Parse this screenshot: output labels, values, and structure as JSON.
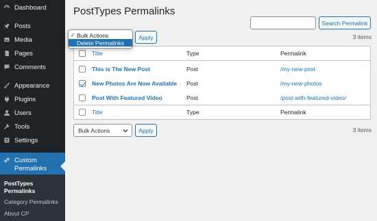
{
  "sidebar": {
    "items": [
      {
        "label": "Dashboard",
        "icon": "dashboard-icon"
      },
      {
        "label": "Posts",
        "icon": "pin-icon"
      },
      {
        "label": "Media",
        "icon": "media-icon"
      },
      {
        "label": "Pages",
        "icon": "pages-icon"
      },
      {
        "label": "Comments",
        "icon": "comments-icon"
      },
      {
        "label": "Appearance",
        "icon": "brush-icon"
      },
      {
        "label": "Plugins",
        "icon": "plugin-icon"
      },
      {
        "label": "Users",
        "icon": "user-icon"
      },
      {
        "label": "Tools",
        "icon": "wrench-icon"
      },
      {
        "label": "Settings",
        "icon": "settings-icon"
      }
    ],
    "active": {
      "label_line1": "Custom",
      "label_line2": "Permalinks",
      "icon": "link-icon"
    },
    "submenu": {
      "current_line1": "PostTypes",
      "current_line2": "Permalinks",
      "items": [
        "Category Permalinks",
        "About CP"
      ]
    }
  },
  "main": {
    "title": "PostTypes Permalinks",
    "search_button": "Search Permalink",
    "search_value": "",
    "apply_label": "Apply",
    "items_count": "3 items",
    "bulk_select_value": "Bulk Actions",
    "dropdown_options": [
      {
        "label": "Bulk Actions",
        "selected": true
      },
      {
        "label": "Delete Permalinks",
        "selected": false,
        "highlighted": true
      }
    ],
    "table": {
      "headers": {
        "title": "Title",
        "type": "Type",
        "permalink": "Permalink"
      },
      "rows": [
        {
          "title": "This is The New Post",
          "type": "Post",
          "permalink": "/my-new-post",
          "checked": false
        },
        {
          "title": "New Photos Are Now Available",
          "type": "Post",
          "permalink": "/my-new-photos",
          "checked": true
        },
        {
          "title": "Post With Featured Video",
          "type": "Post",
          "permalink": "/post-with-featured-video/",
          "checked": false
        }
      ]
    }
  },
  "colors": {
    "accent": "#2271b1",
    "sidebar_bg": "#1d2327",
    "page_bg": "#f0f0f1"
  }
}
